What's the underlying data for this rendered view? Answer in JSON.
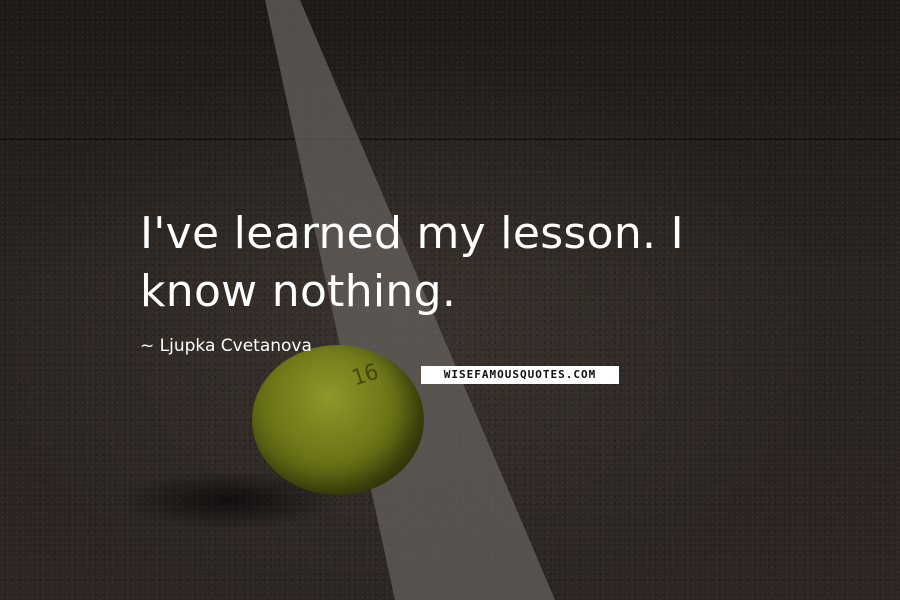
{
  "quote": {
    "text": "I've learned my lesson. I know nothing.",
    "author": "Ljupka Cvetanova"
  },
  "watermark": "WISEFAMOUSQUOTES.COM",
  "ball_number": "16",
  "colors": {
    "text": "#ffffff",
    "court": "#3a322d",
    "ball": "#a8b22a"
  }
}
